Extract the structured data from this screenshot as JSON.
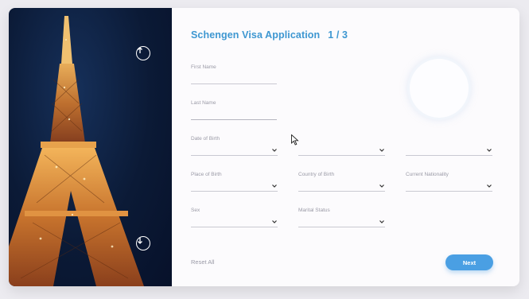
{
  "header": {
    "title": "Schengen Visa Application",
    "step": "1 / 3"
  },
  "fields": {
    "first_name": {
      "label": "First Name",
      "value": ""
    },
    "last_name": {
      "label": "Last Name",
      "value": ""
    },
    "date_of_birth": {
      "label": "Date of Birth",
      "day": "",
      "month": "",
      "year": ""
    },
    "place_of_birth": {
      "label": "Place of Birth",
      "value": ""
    },
    "country_of_birth": {
      "label": "Country of Birth",
      "value": ""
    },
    "current_nationality": {
      "label": "Current Nationality",
      "value": ""
    },
    "sex": {
      "label": "Sex",
      "value": ""
    },
    "marital_status": {
      "label": "Marital Status",
      "value": ""
    }
  },
  "actions": {
    "reset_label": "Reset All",
    "next_label": "Next"
  },
  "icons": {
    "scroll_up": "arrow-up-icon",
    "scroll_down": "arrow-down-icon",
    "dropdown": "chevron-down-icon",
    "pointer": "mouse-cursor-icon"
  },
  "colors": {
    "accent": "#3e97d1",
    "button": "#4a9fe3",
    "photo_bg": "#0b1a36"
  }
}
